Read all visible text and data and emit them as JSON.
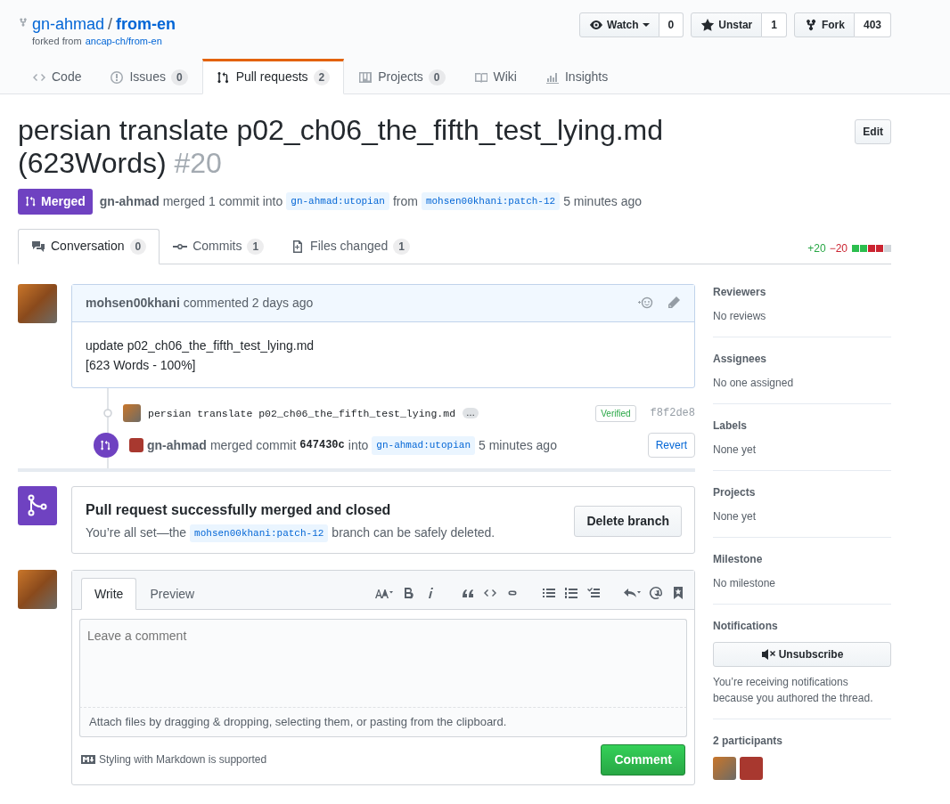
{
  "repo": {
    "owner": "gn-ahmad",
    "separator": "/",
    "name": "from-en",
    "forked_prefix": "forked from",
    "forked_from": "ancap-ch/from-en"
  },
  "repo_actions": [
    {
      "kind": "watch",
      "label": "Watch",
      "count": "0"
    },
    {
      "kind": "star",
      "label": "Unstar",
      "count": "1"
    },
    {
      "kind": "fork",
      "label": "Fork",
      "count": "403"
    }
  ],
  "repo_tabs": [
    {
      "kind": "code",
      "label": "Code",
      "selected": false
    },
    {
      "kind": "issues",
      "label": "Issues",
      "count": "0",
      "selected": false
    },
    {
      "kind": "pulls",
      "label": "Pull requests",
      "count": "2",
      "selected": true
    },
    {
      "kind": "projects",
      "label": "Projects",
      "count": "0",
      "selected": false
    },
    {
      "kind": "wiki",
      "label": "Wiki",
      "selected": false
    },
    {
      "kind": "insights",
      "label": "Insights",
      "selected": false
    }
  ],
  "pr": {
    "title": "persian translate p02_ch06_the_fifth_test_lying.md (623Words)",
    "number": "#20",
    "edit": "Edit",
    "state": "Merged",
    "author": "gn-ahmad",
    "merged_text": "merged 1 commit into",
    "base": "gn-ahmad:utopian",
    "from_text": "from",
    "head": "mohsen00khani:patch-12",
    "time": "5 minutes ago"
  },
  "pr_tabs": [
    {
      "kind": "conversation",
      "label": "Conversation",
      "count": "0",
      "selected": true
    },
    {
      "kind": "commits",
      "label": "Commits",
      "count": "1",
      "selected": false
    },
    {
      "kind": "files",
      "label": "Files changed",
      "count": "1",
      "selected": false
    }
  ],
  "diffstat": {
    "additions": "+20",
    "deletions": "−20",
    "blocks": [
      {
        "color": "#2cbe4e"
      },
      {
        "color": "#2cbe4e"
      },
      {
        "color": "#cb2431"
      },
      {
        "color": "#cb2431"
      },
      {
        "color": "#d1d5da"
      }
    ]
  },
  "comment": {
    "author": "mohsen00khani",
    "action": "commented 2 days ago",
    "body": [
      "update p02_ch06_the_fifth_test_lying.md",
      "[623 Words - 100%]"
    ]
  },
  "commit": {
    "message": "persian translate p02_ch06_the_fifth_test_lying.md",
    "more": "…",
    "verified": "Verified",
    "sha": "f8f2de8"
  },
  "merge_event": {
    "actor": "gn-ahmad",
    "text": "merged commit",
    "sha": "647430c",
    "into": "into",
    "branch": "gn-ahmad:utopian",
    "time": "5 minutes ago",
    "revert": "Revert"
  },
  "merged_box": {
    "title": "Pull request successfully merged and closed",
    "before": "You’re all set—the",
    "branch": "mohsen00khani:patch-12",
    "after": "branch can be safely deleted.",
    "button": "Delete branch"
  },
  "editor": {
    "tabs": [
      {
        "label": "Write",
        "selected": true
      },
      {
        "label": "Preview",
        "selected": false
      }
    ],
    "placeholder": "Leave a comment",
    "attach_before": "Attach files by dragging & dropping,",
    "attach_link": "selecting them",
    "attach_after": ", or pasting from the clipboard.",
    "markdown_note": "Styling with Markdown is supported",
    "submit": "Comment"
  },
  "sidebar": {
    "sections": [
      {
        "title": "Reviewers",
        "value": "No reviews"
      },
      {
        "title": "Assignees",
        "value": "No one assigned"
      },
      {
        "title": "Labels",
        "value": "None yet"
      },
      {
        "title": "Projects",
        "value": "None yet"
      },
      {
        "title": "Milestone",
        "value": "No milestone"
      }
    ],
    "notifications": {
      "title": "Notifications",
      "button": "Unsubscribe",
      "note": "You’re receiving notifications because you authored the thread."
    },
    "participants": {
      "title": "2 participants"
    }
  }
}
